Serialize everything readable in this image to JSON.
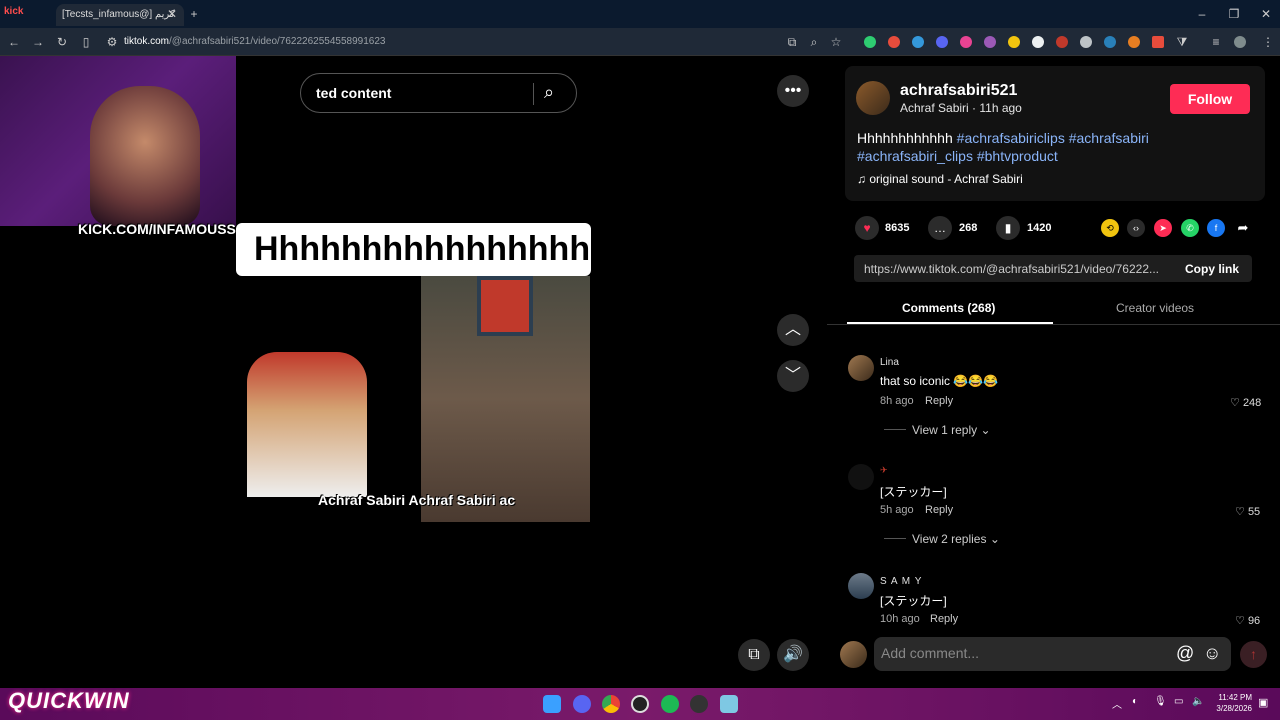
{
  "browser": {
    "tab_title": "[Tecsts_infamous@] كريم",
    "url_host": "tiktok.com",
    "url_path": "/@achrafsabiri521/video/7622262554558991623"
  },
  "overlay": {
    "kick_text": "KICK.COM/INFAMOUSS",
    "brand": "QUICKWIN"
  },
  "video": {
    "search_text": "ted content",
    "caption": "Hhhhhhhhhhhhhhhhh",
    "socials": "Achraf Sabiri  Achraf Sabiri  ac"
  },
  "post": {
    "username": "achrafsabiri521",
    "sub": "Achraf Sabiri · 11h ago",
    "follow_label": "Follow",
    "desc_text": "Hhhhhhhhhhhh",
    "tags": [
      "#achrafsabiriclips",
      "#achrafsabiri",
      "#achrafsabiri_clips",
      "#bhtvproduct"
    ],
    "sound": "original sound - Achraf Sabiri",
    "likes": "8635",
    "comments": "268",
    "saves": "1420",
    "link": "https://www.tiktok.com/@achrafsabiri521/video/76222...",
    "copy_label": "Copy link"
  },
  "tabs": {
    "comments": "Comments (268)",
    "creator": "Creator videos"
  },
  "comments": [
    {
      "name": "Lina",
      "text": "that so iconic 😂😂😂",
      "time": "8h ago",
      "reply": "Reply",
      "likes": "248",
      "view": "View 1 reply"
    },
    {
      "name": "",
      "text": "[ステッカー]",
      "time": "5h ago",
      "reply": "Reply",
      "likes": "55",
      "view": "View 2 replies"
    },
    {
      "name": "S A M Y",
      "text": "[ステッカー]",
      "time": "10h ago",
      "reply": "Reply",
      "likes": "96"
    }
  ],
  "composer": {
    "placeholder": "Add comment..."
  },
  "clock": {
    "time": "11:42 PM",
    "date": "3/28/2026"
  }
}
